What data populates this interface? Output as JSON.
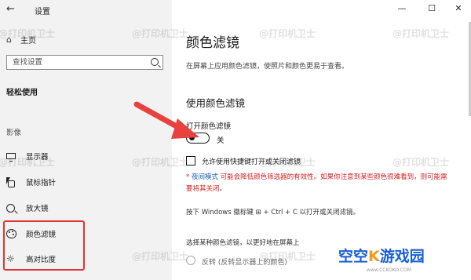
{
  "sidebar": {
    "app_title": "设置",
    "home_label": "主页",
    "search_placeholder": "查找设置",
    "section_heading": "轻松使用",
    "group_label": "影像",
    "items": [
      {
        "label": "显示器",
        "icon": "monitor-icon"
      },
      {
        "label": "鼠标指针",
        "icon": "mouse-pointer-icon"
      },
      {
        "label": "放大镜",
        "icon": "magnifier-icon"
      },
      {
        "label": "颜色滤镜",
        "icon": "palette-icon"
      },
      {
        "label": "高对比度",
        "icon": "contrast-sun-icon"
      }
    ]
  },
  "window_controls": {
    "minimize": "—",
    "maximize": "☐",
    "close": "✕"
  },
  "main": {
    "title": "颜色滤镜",
    "description": "在屏幕上应用颜色滤镜，使照片和颜色更易于查看。",
    "subheading": "使用颜色滤镜",
    "toggle_label": "打开颜色滤镜",
    "toggle_state": "关",
    "toggle_on": false,
    "shortcut_checkbox_label": "允许使用快捷键打开或关闭滤镜",
    "shortcut_checked": false,
    "warning_star": "* ",
    "warning_link": "夜间模式",
    "warning_text": " 可能会降低颜色筛选器的有效性。如果你注意到某些颜色很难看到，则可能需要将其关闭。",
    "shortcut_hint": "按下 Windows 徽标键 ⊞ + Ctrl + C 以打开或关闭滤镜。",
    "choose_filter_text": "选择某种颜色滤镜，以更好地在屏幕上",
    "radio_option": "反转",
    "radio_note": "(反转显示器上的颜色)"
  },
  "watermark": "@打印机卫士",
  "logo": {
    "text_a": "空空",
    "text_k": "K",
    "text_b": "游戏园",
    "url": "www.CCKOKO.COM"
  },
  "colors": {
    "sidebar_bg": "#f2f2f2",
    "highlight_red": "#e03535",
    "warning_red": "#d21f1f",
    "link_blue": "#1259b8"
  }
}
